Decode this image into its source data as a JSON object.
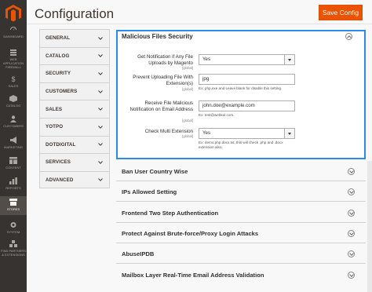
{
  "header": {
    "title": "Configuration",
    "save_label": "Save Config"
  },
  "admin_nav": [
    {
      "label": "DASHBOARD",
      "icon": "dashboard-icon"
    },
    {
      "label": "WEB APPLICATION FIREWALL",
      "icon": "firewall-icon"
    },
    {
      "label": "SALES",
      "icon": "dollar-icon"
    },
    {
      "label": "CATALOG",
      "icon": "box-icon"
    },
    {
      "label": "CUSTOMERS",
      "icon": "person-icon"
    },
    {
      "label": "MARKETING",
      "icon": "megaphone-icon"
    },
    {
      "label": "CONTENT",
      "icon": "layout-icon"
    },
    {
      "label": "REPORTS",
      "icon": "bar-chart-icon"
    },
    {
      "label": "STORES",
      "icon": "store-icon",
      "active": true
    },
    {
      "label": "SYSTEM",
      "icon": "gear-icon"
    },
    {
      "label": "FIND PARTNERS & EXTENSIONS",
      "icon": "cubes-icon"
    }
  ],
  "tabs": [
    "GENERAL",
    "CATALOG",
    "SECURITY",
    "CUSTOMERS",
    "SALES",
    "YOTPO",
    "DOTDIGITAL",
    "SERVICES",
    "ADVANCED"
  ],
  "malicious": {
    "title": "Malicious Files Security",
    "fields": [
      {
        "label": "Get Notification if Any File Uploads by Magento",
        "scope": "[global]",
        "value": "Yes",
        "type": "select"
      },
      {
        "label": "Prevent Uploading File With Extension(s)",
        "scope": "[global]",
        "value": "jpg",
        "type": "text",
        "note": "Ex: php,exe and Leave blank for disable this setting."
      },
      {
        "label": "Receive File Malicious Notification on Email Address",
        "scope": "[global]",
        "value": "john.doe@example.com",
        "type": "text",
        "note": "Ex: test@webkul.com."
      },
      {
        "label": "Check Multi Extension",
        "scope": "[global]",
        "value": "Yes",
        "type": "select",
        "note": "Ex: demo.php.docx.txt, this will check .php and .docx extension also."
      }
    ]
  },
  "sections": [
    "Ban User Country Wise",
    "IPs Allowed Setting",
    "Frontend Two Step Authentication",
    "Protect Against Brute-force/Proxy Login Attacks",
    "AbuseIPDB",
    "Mailbox Layer Real-Time Email Address Validation"
  ],
  "colors": {
    "sidebar": "#373330",
    "accent": "#eb5202",
    "focus": "#2a8ce6"
  }
}
